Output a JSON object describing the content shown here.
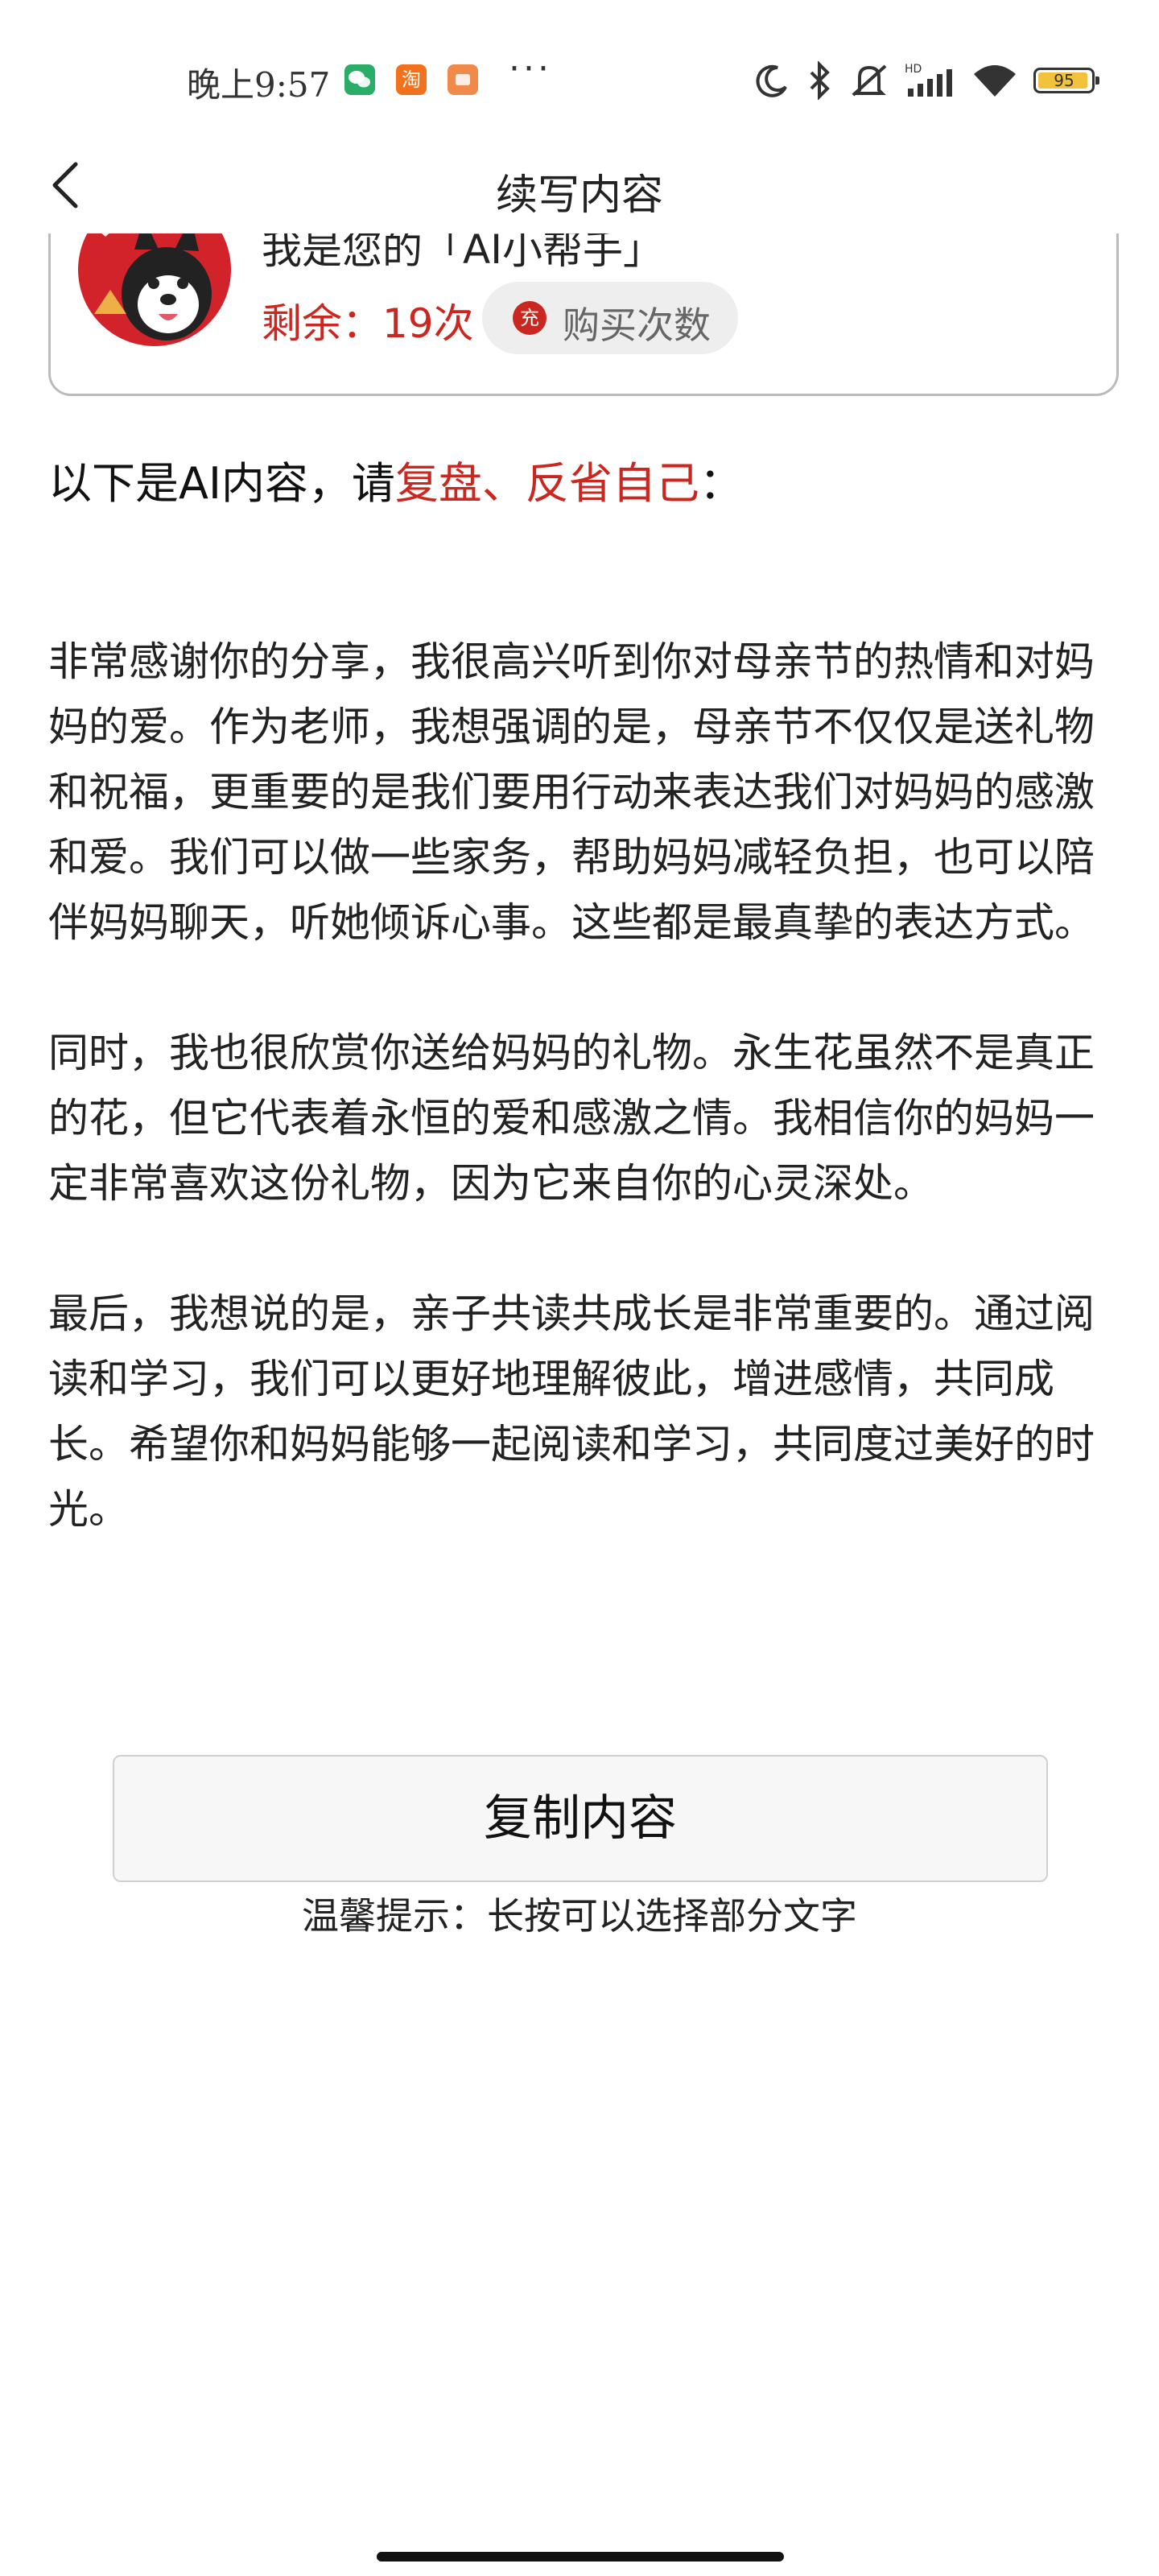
{
  "status_bar": {
    "time": "晚上9:57",
    "app_icons": [
      "wechat-icon",
      "taobao-icon",
      "notification-app-icon"
    ],
    "more": "···",
    "battery_level": "95",
    "battery_fraction": 0.95
  },
  "header": {
    "title": "续写内容"
  },
  "card": {
    "greeting": "我是您的「AI小帮手」",
    "remaining": "剩余：19次",
    "buy_icon_text": "充",
    "buy_label": "购买次数"
  },
  "prompt": {
    "prefix": "以下是AI内容，请",
    "highlight": "复盘、反省自己",
    "suffix": "："
  },
  "content": {
    "paragraphs": [
      "非常感谢你的分享，我很高兴听到你对母亲节的热情和对妈妈的爱。作为老师，我想强调的是，母亲节不仅仅是送礼物和祝福，更重要的是我们要用行动来表达我们对妈妈的感激和爱。我们可以做一些家务，帮助妈妈减轻负担，也可以陪伴妈妈聊天，听她倾诉心事。这些都是最真挚的表达方式。",
      "同时，我也很欣赏你送给妈妈的礼物。永生花虽然不是真正的花，但它代表着永恒的爱和感激之情。我相信你的妈妈一定非常喜欢这份礼物，因为它来自你的心灵深处。",
      "最后，我想说的是，亲子共读共成长是非常重要的。通过阅读和学习，我们可以更好地理解彼此，增进感情，共同成长。希望你和妈妈能够一起阅读和学习，共同度过美好的时光。"
    ]
  },
  "actions": {
    "copy_label": "复制内容",
    "tip": "温馨提示：长按可以选择部分文字"
  },
  "colors": {
    "accent_red": "#c9271f",
    "text": "#222222",
    "button_bg": "#f7f7f7"
  }
}
